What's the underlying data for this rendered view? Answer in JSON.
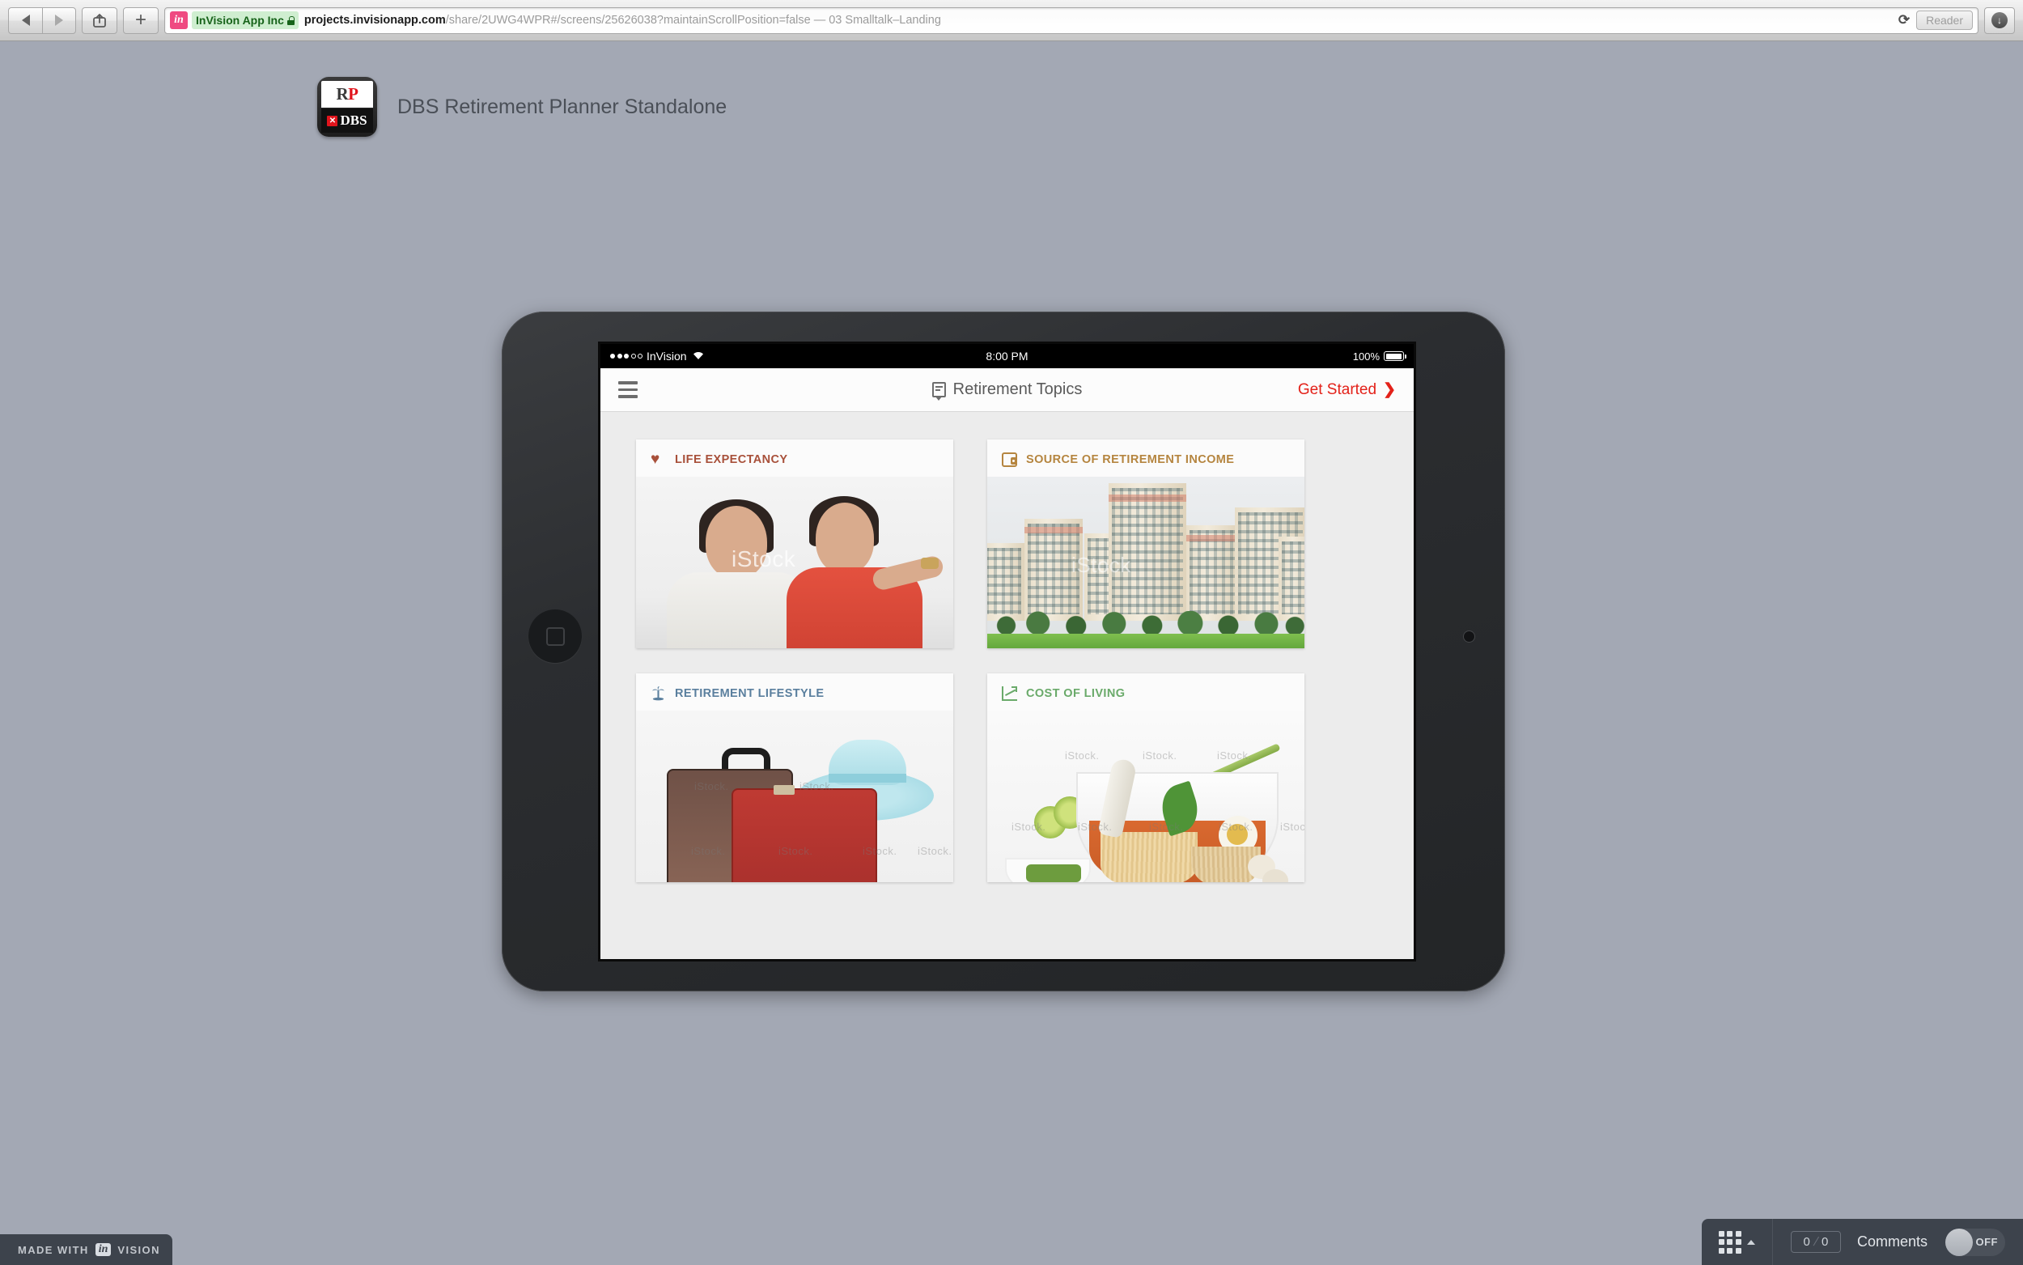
{
  "browser": {
    "back_icon": "back-arrow-icon",
    "forward_icon": "forward-arrow-icon",
    "share_icon": "share-icon",
    "newtab_label": "+",
    "favicon_text": "in",
    "security_badge": "InVision App Inc",
    "url_host": "projects.invisionapp.com",
    "url_path": "/share/2UWG4WPR#/screens/25626038?maintainScrollPosition=false — 03 Smalltalk–Landing",
    "reload_glyph": "⟳",
    "reader_label": "Reader",
    "download_glyph": "↓"
  },
  "project": {
    "icon_top_r": "R",
    "icon_top_p": "P",
    "icon_x": "✕",
    "icon_brand": "DBS",
    "title": "DBS Retirement Planner Standalone"
  },
  "device": {
    "status_bar": {
      "carrier": "InVision",
      "wifi_glyph": "◥",
      "time": "8:00 PM",
      "battery_percent": "100%"
    },
    "nav_bar": {
      "menu_icon": "hamburger-icon",
      "title_icon": "speech-bubble-icon",
      "title": "Retirement Topics",
      "action_label": "Get Started",
      "action_chevron": "❯",
      "action_color": "#e32119"
    },
    "cards": [
      {
        "id": "life-expectancy",
        "label": "LIFE EXPECTANCY",
        "icon": "heart-icon",
        "color": "#a8503a",
        "photo": "asian-couple-photo",
        "watermark": "iStock"
      },
      {
        "id": "source-of-retirement-income",
        "label": "SOURCE OF RETIREMENT INCOME",
        "icon": "wallet-icon",
        "color": "#b5853f",
        "photo": "hdb-apartment-blocks-photo",
        "watermark": "iStock"
      },
      {
        "id": "retirement-lifestyle",
        "label": "RETIREMENT LIFESTYLE",
        "icon": "palm-tree-icon",
        "color": "#5a7f9e",
        "photo": "suitcases-and-sun-hat-photo",
        "watermark": "iStock."
      },
      {
        "id": "cost-of-living",
        "label": "COST OF LIVING",
        "icon": "line-chart-icon",
        "color": "#6aaa6a",
        "photo": "laksa-noodle-soup-photo",
        "watermark": "iStock."
      }
    ]
  },
  "footer": {
    "made_with_label": "MADE WITH",
    "made_with_brand_chip": "in",
    "made_with_brand": "VISION",
    "grid_icon": "grid-icon",
    "grid_caret": "caret-up-icon",
    "comment_count": "0",
    "comment_total": "0",
    "comments_label": "Comments",
    "toggle_state": "OFF"
  }
}
